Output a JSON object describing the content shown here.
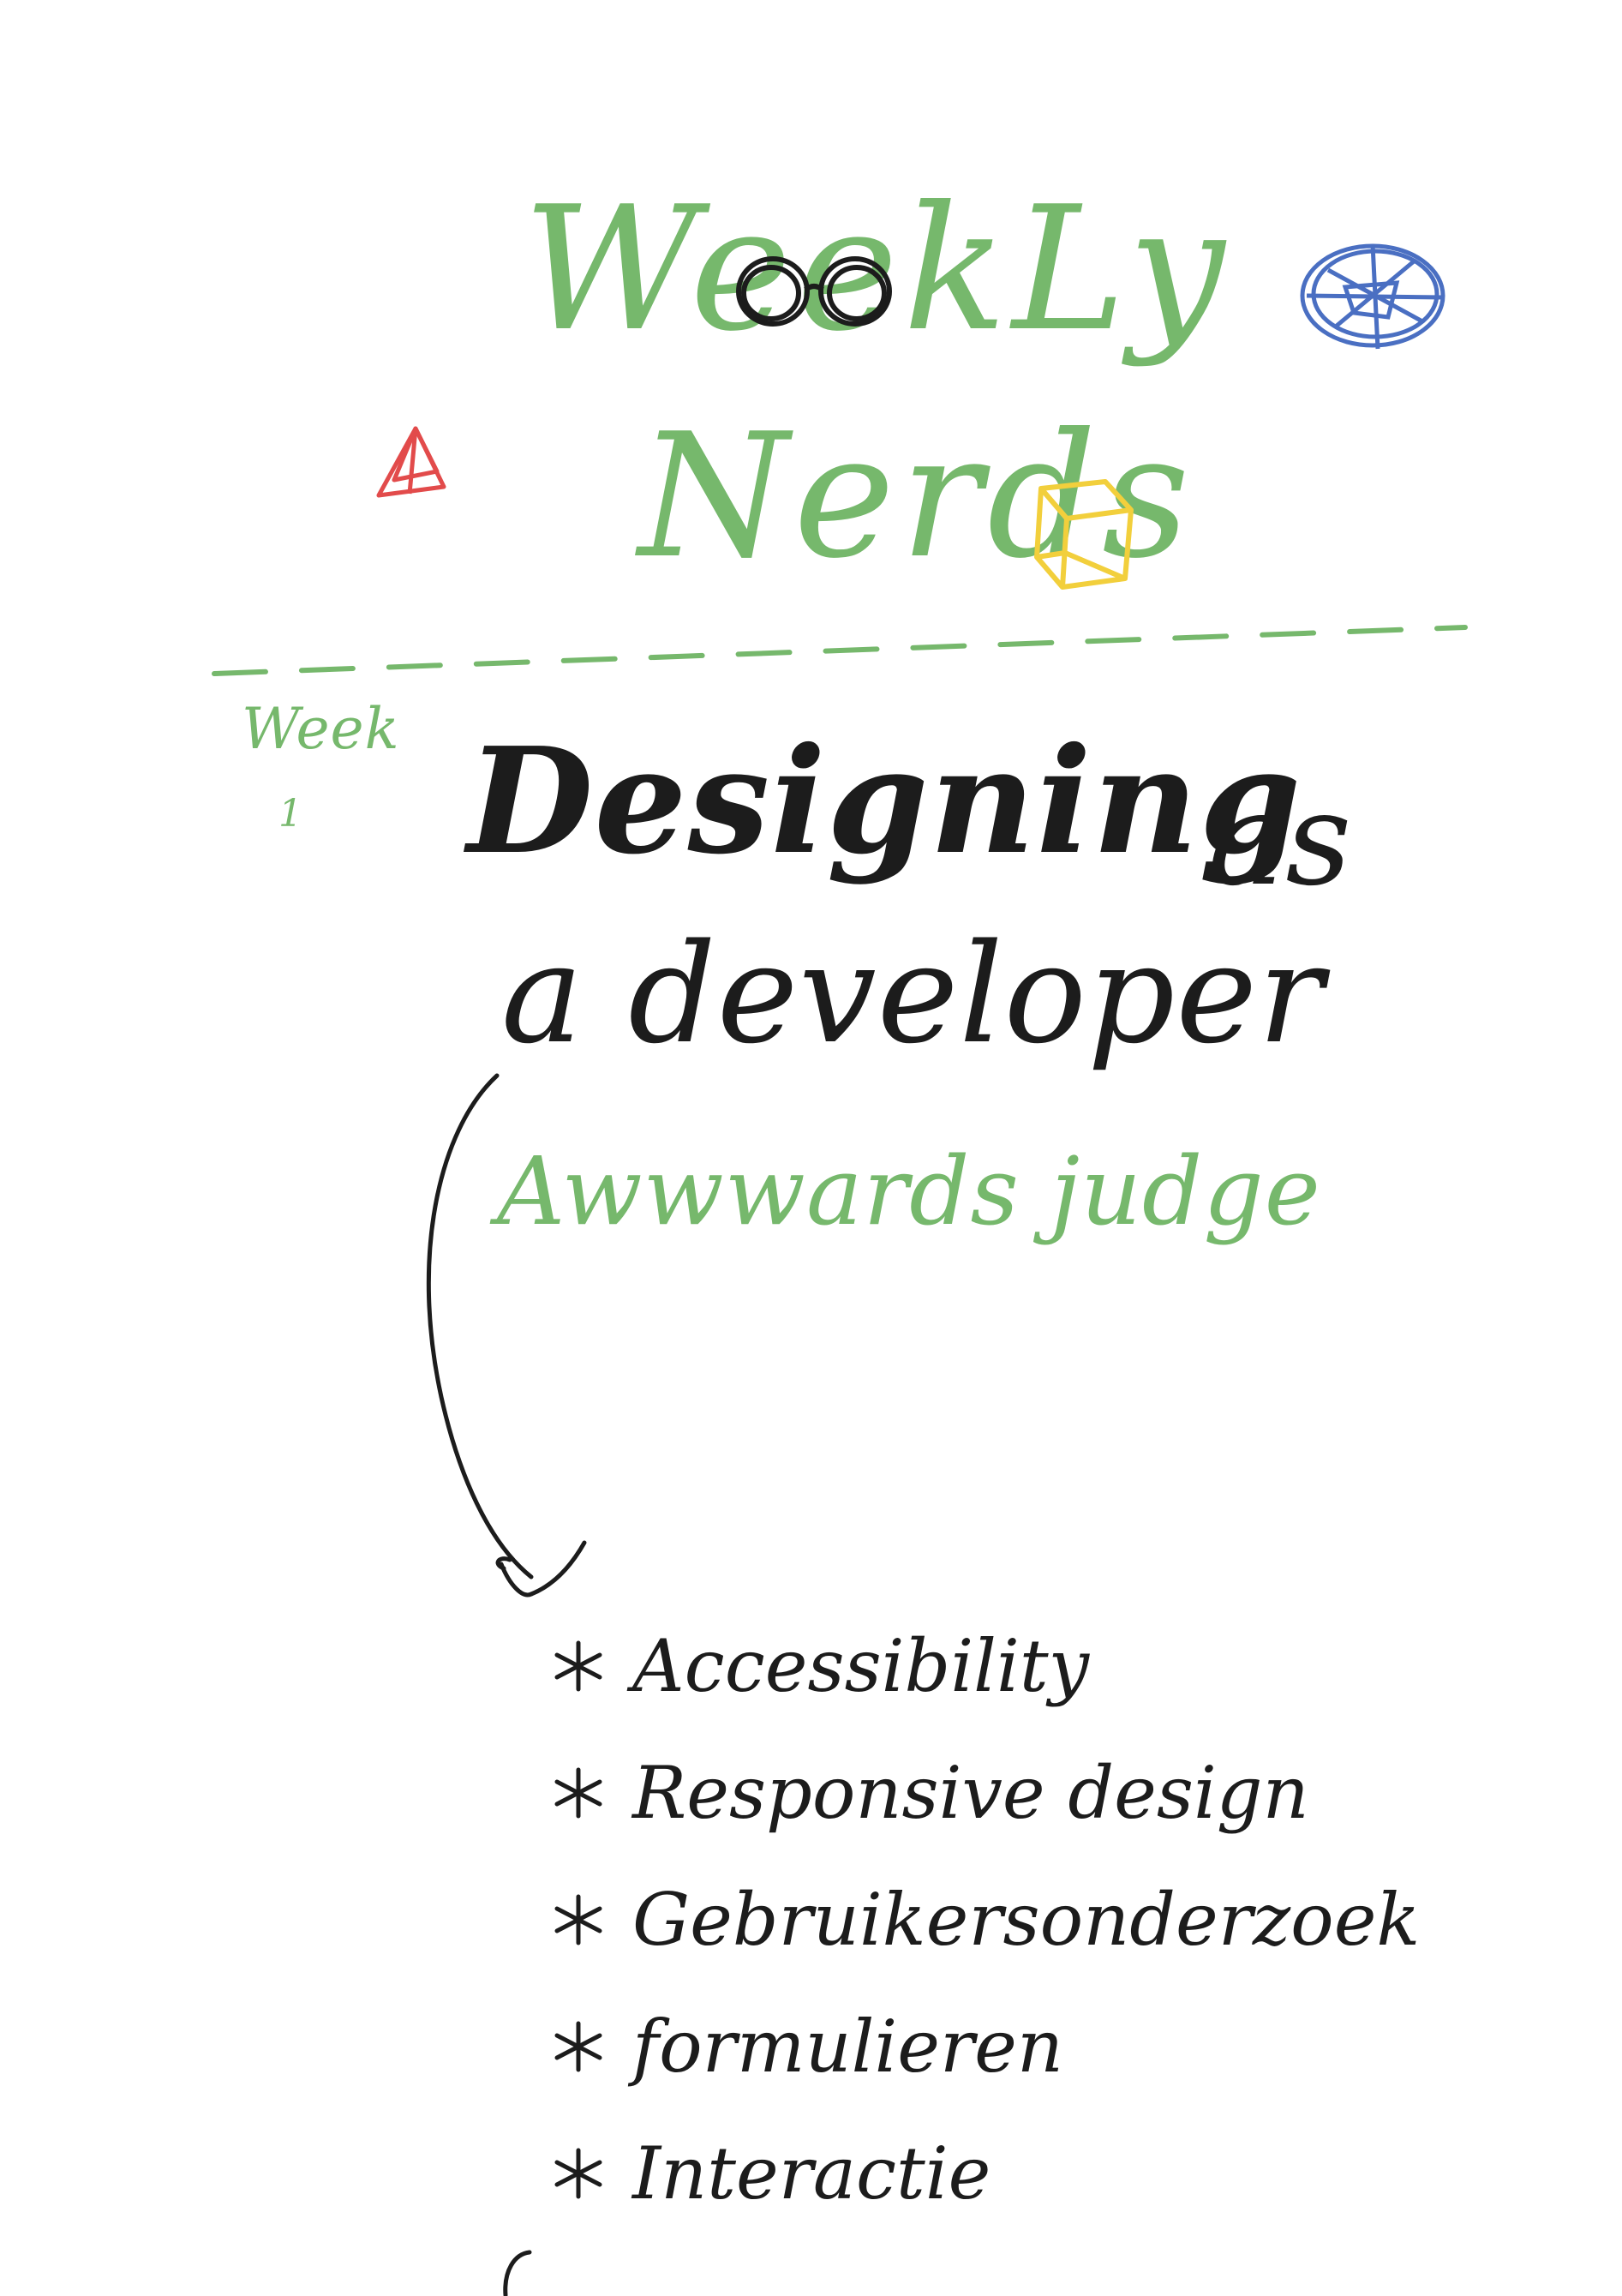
{
  "title": {
    "line1": "WeekLy",
    "line2": "Nerds"
  },
  "week": {
    "label": "Week",
    "number": "1"
  },
  "heading": {
    "part1": "Designing",
    "part1b": "as",
    "part2": "a developer"
  },
  "subheading": "Awwwards judge",
  "topics": [
    "Accessibility",
    "Responsive design",
    "Gebruikersonderzoek",
    "formulieren",
    "Interactie"
  ],
  "colors": {
    "green": "#76b86c",
    "ink": "#1c1c1c",
    "red": "#e24b4b",
    "blue": "#4a6fc2",
    "yellow": "#f2cf3c"
  },
  "icons": [
    "glasses-icon",
    "pyramid-icon",
    "cube-icon",
    "atom-icon",
    "dashed-divider",
    "curved-arrow",
    "asterisk-bullet-icon"
  ]
}
